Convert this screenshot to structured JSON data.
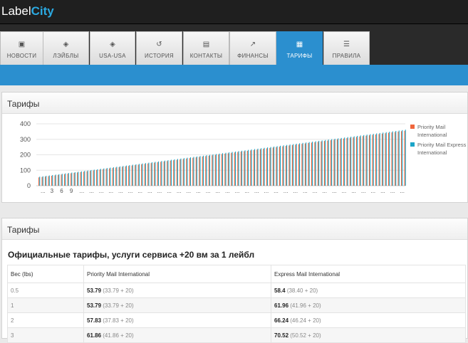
{
  "app": {
    "logo_part1": "Label",
    "logo_part2": "City"
  },
  "nav": {
    "tabs": [
      {
        "label": "НОВОСТИ",
        "icon": "news-icon",
        "active": false
      },
      {
        "label": "ЛЭЙБЛЫ",
        "icon": "layers-icon",
        "active": false
      },
      {
        "label": "USA-USA",
        "icon": "layers-icon",
        "active": false
      },
      {
        "label": "ИСТОРИЯ",
        "icon": "history-icon",
        "active": false
      },
      {
        "label": "КОНТАКТЫ",
        "icon": "contacts-icon",
        "active": false
      },
      {
        "label": "ФИНАНСЫ",
        "icon": "chart-icon",
        "active": false
      },
      {
        "label": "ТАРИФЫ",
        "icon": "table-icon",
        "active": true
      },
      {
        "label": "ПРАВИЛА",
        "icon": "list-icon",
        "active": false
      }
    ]
  },
  "chart_panel": {
    "title": "Тарифы"
  },
  "table_panel": {
    "title": "Тарифы",
    "heading": "Официальные тарифы, услуги сервиса +20 вм за 1 лейбл"
  },
  "colors": {
    "priority": "#f0663c",
    "express": "#1ba5c8",
    "accent": "#2b8fcf"
  },
  "chart_data": {
    "type": "bar",
    "ylim": [
      0,
      400
    ],
    "yticks": [
      0,
      100,
      200,
      300,
      400
    ],
    "xticks": [
      "...",
      "3",
      "6",
      "9",
      "...",
      "...",
      "...",
      "...",
      "...",
      "...",
      "...",
      "...",
      "...",
      "...",
      "...",
      "...",
      "...",
      "...",
      "...",
      "...",
      "...",
      "...",
      "...",
      "...",
      "...",
      "...",
      "...",
      "...",
      "...",
      "...",
      "...",
      "...",
      "...",
      "...",
      "...",
      "...",
      "...",
      "..."
    ],
    "category_count": 115,
    "series": [
      {
        "name": "Priority Mail International",
        "start": 53.79,
        "end": 355
      },
      {
        "name": "Priority Mail Express International",
        "start": 58.4,
        "end": 362
      }
    ],
    "legend_position": "right"
  },
  "table": {
    "headers": [
      "Вес (lbs)",
      "Priority Mail International",
      "Express Mail International"
    ],
    "rows": [
      {
        "weight": "0.5",
        "p_total": "53.79",
        "p_detail": "(33.79 + 20)",
        "e_total": "58.4",
        "e_detail": "(38.40 + 20)"
      },
      {
        "weight": "1",
        "p_total": "53.79",
        "p_detail": "(33.79 + 20)",
        "e_total": "61.96",
        "e_detail": "(41.96 + 20)"
      },
      {
        "weight": "2",
        "p_total": "57.83",
        "p_detail": "(37.83 + 20)",
        "e_total": "66.24",
        "e_detail": "(46.24 + 20)"
      },
      {
        "weight": "3",
        "p_total": "61.86",
        "p_detail": "(41.86 + 20)",
        "e_total": "70.52",
        "e_detail": "(50.52 + 20)"
      }
    ]
  }
}
